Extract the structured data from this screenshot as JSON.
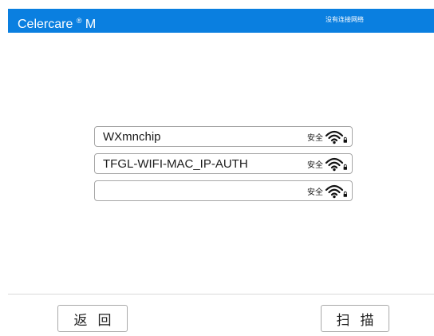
{
  "header": {
    "app_name": "Celercare",
    "registered_mark": "®",
    "model": "M",
    "network_status": "没有连接网络"
  },
  "wifi_networks": [
    {
      "ssid": "WXmnchip",
      "security": "安全",
      "icon": "wifi-locked-icon"
    },
    {
      "ssid": "TFGL-WIFI-MAC_IP-AUTH",
      "security": "安全",
      "icon": "wifi-locked-icon"
    },
    {
      "ssid": "",
      "security": "安全",
      "icon": "wifi-locked-icon"
    }
  ],
  "footer": {
    "back_label": "返回",
    "scan_label": "扫描"
  },
  "colors": {
    "header_bg": "#0a7fe0",
    "header_text": "#ffffff"
  }
}
